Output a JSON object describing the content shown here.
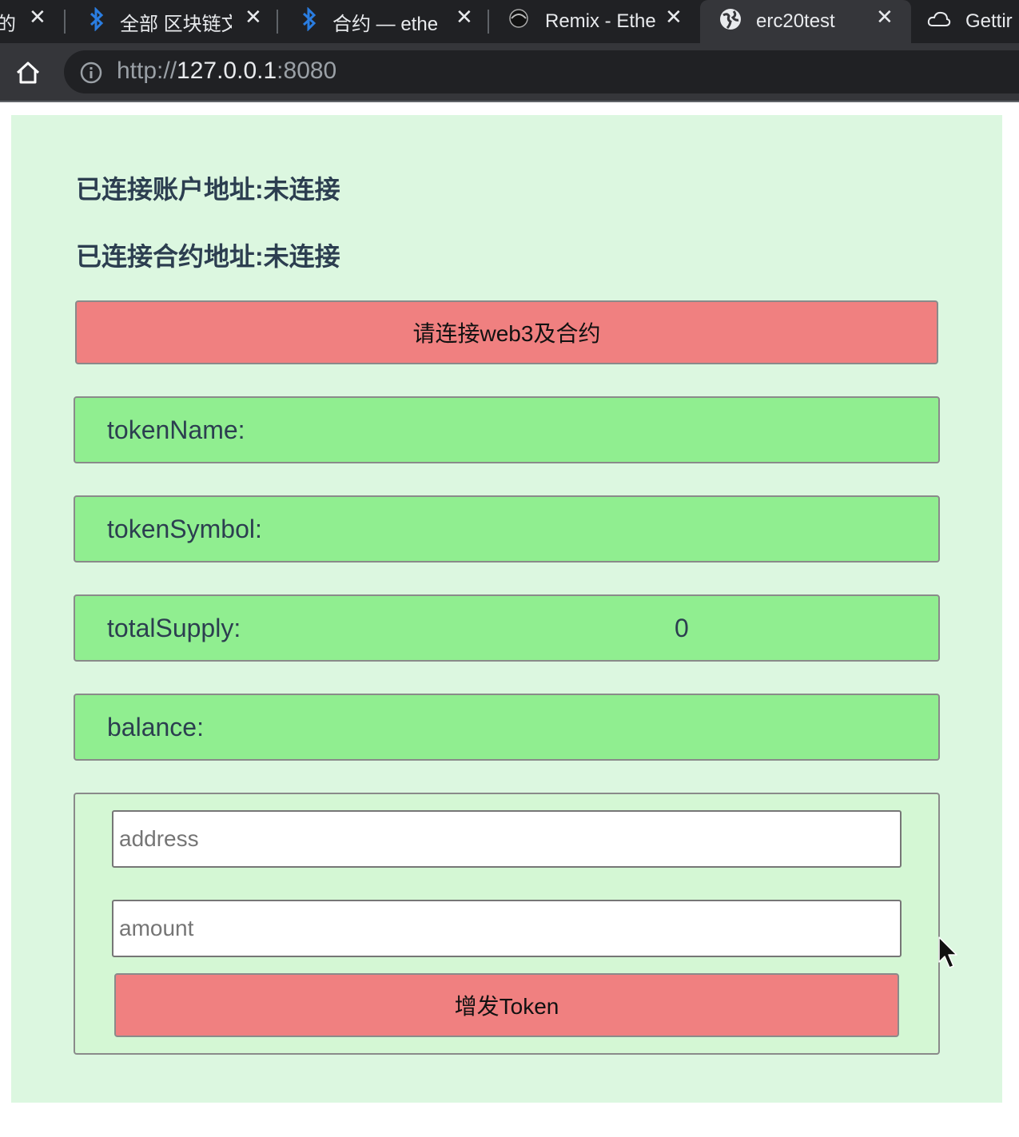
{
  "browser": {
    "tabs": [
      {
        "title": "的",
        "active": false
      },
      {
        "title": "全部 区块链文",
        "active": false
      },
      {
        "title": "合约 — ethe",
        "active": false
      },
      {
        "title": "Remix - Ethe",
        "active": false
      },
      {
        "title": "erc20test",
        "active": true
      },
      {
        "title": "Gettir",
        "active": false
      }
    ],
    "url_scheme": "http://",
    "url_host": "127.0.0.1",
    "url_port": ":8080"
  },
  "page": {
    "account_line": "已连接账户地址:未连接",
    "contract_line": "已连接合约地址:未连接",
    "connect_button": "请连接web3及合约",
    "fields": [
      {
        "label": "tokenName:",
        "value": ""
      },
      {
        "label": "tokenSymbol:",
        "value": ""
      },
      {
        "label": "totalSupply:",
        "value": "0"
      },
      {
        "label": "balance:",
        "value": ""
      }
    ],
    "mint": {
      "address_placeholder": "address",
      "address_value": "",
      "amount_placeholder": "amount",
      "amount_value": "",
      "button": "增发Token"
    }
  },
  "colors": {
    "page_bg": "#dcf7e0",
    "field_bg": "#90ee90",
    "button_bg": "#f08080",
    "text": "#2c3e50"
  }
}
